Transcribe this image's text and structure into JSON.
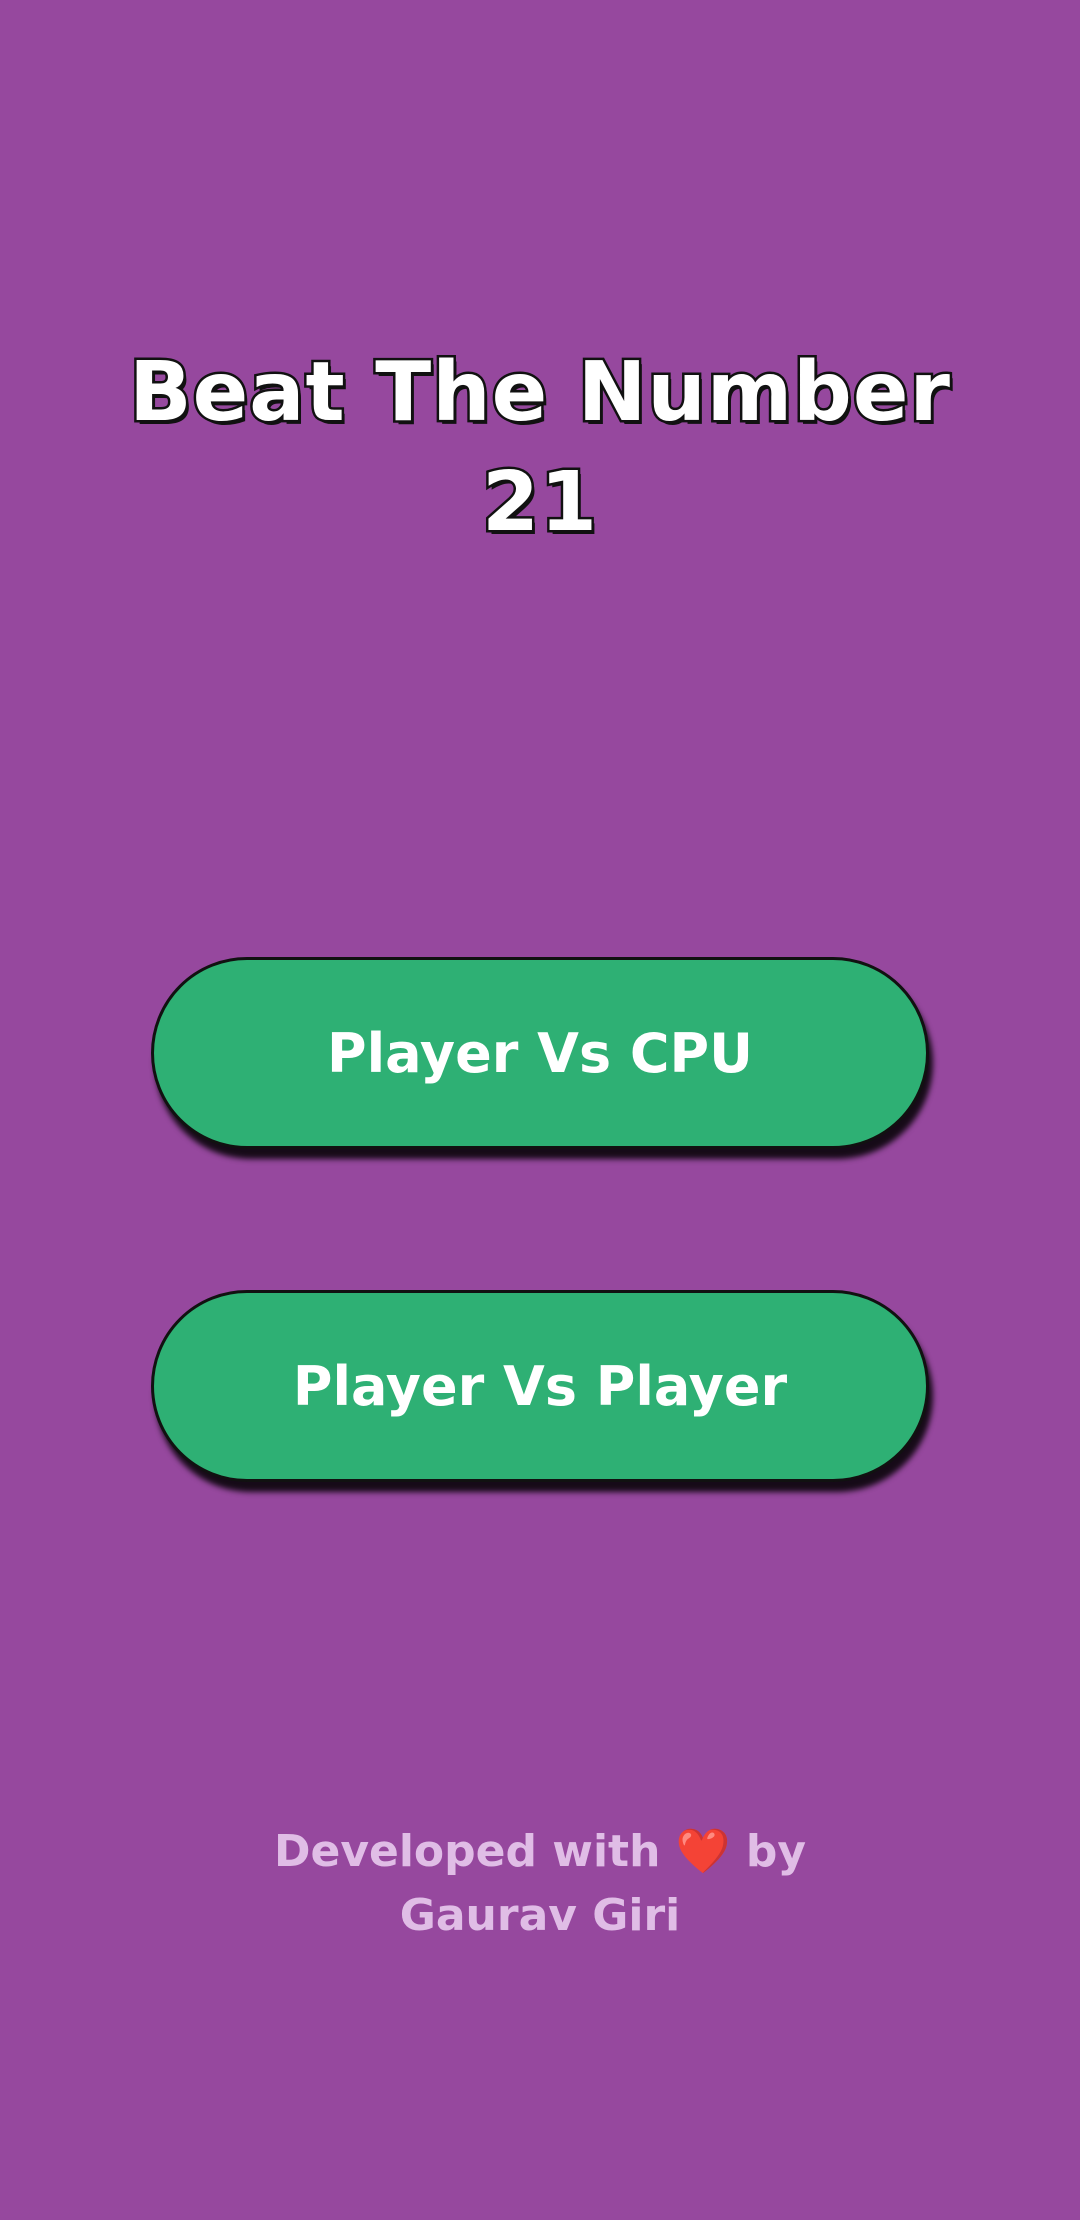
{
  "app": {
    "title_line1": "Beat The Number",
    "title_line2": "21"
  },
  "menu": {
    "cpu_button_label": "Player Vs CPU",
    "pvp_button_label": "Player Vs Player"
  },
  "footer": {
    "prefix": "Developed with",
    "heart": "❤️",
    "suffix": "by",
    "author": "Gaurav Giri"
  },
  "colors": {
    "background": "#96489e",
    "button": "#2eb074",
    "footer_text": "#e0bde6",
    "heart": "#e53945"
  }
}
